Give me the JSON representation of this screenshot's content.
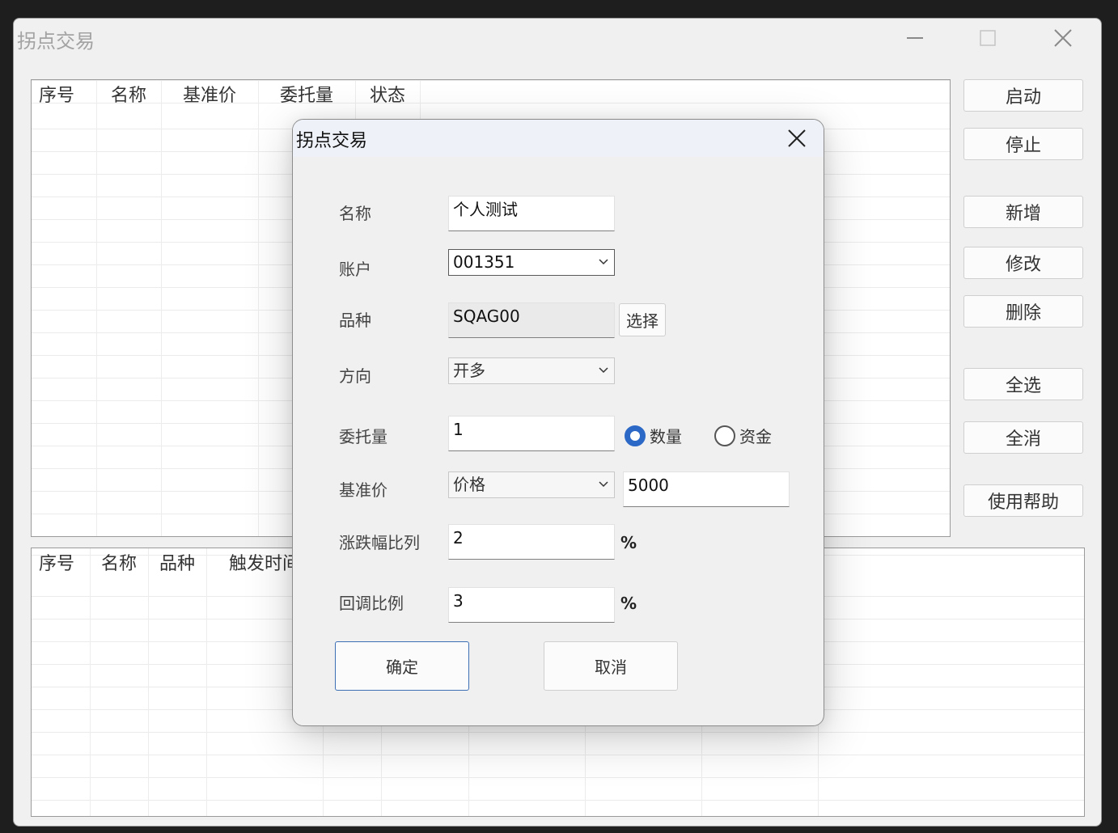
{
  "main_window": {
    "title": "拐点交易"
  },
  "top_table": {
    "columns": [
      "序号",
      "名称",
      "基准价",
      "委托量",
      "状态"
    ]
  },
  "bottom_table": {
    "columns": [
      "序号",
      "名称",
      "品种",
      "触发时间"
    ]
  },
  "side_buttons": {
    "start": "启动",
    "stop": "停止",
    "add": "新增",
    "edit": "修改",
    "delete": "删除",
    "select_all": "全选",
    "deselect_all": "全消",
    "help": "使用帮助"
  },
  "dialog": {
    "title": "拐点交易",
    "fields": {
      "name_label": "名称",
      "name_value": "个人测试",
      "account_label": "账户",
      "account_value": "001351",
      "symbol_label": "品种",
      "symbol_value": "SQAG00",
      "choose_button": "选择",
      "direction_label": "方向",
      "direction_value": "开多",
      "quantity_label": "委托量",
      "quantity_value": "1",
      "radio_quantity": "数量",
      "radio_funds": "资金",
      "radio_selected": "数量",
      "baseprice_label": "基准价",
      "baseprice_type": "价格",
      "baseprice_value": "5000",
      "change_ratio_label": "涨跌幅比列",
      "change_ratio_value": "2",
      "retrace_label": "回调比例",
      "retrace_value": "3",
      "percent_unit": "%"
    },
    "ok_button": "确定",
    "cancel_button": "取消"
  },
  "icons": {
    "minimize": "minimize-icon",
    "maximize": "maximize-icon",
    "close": "close-icon",
    "dropdown": "chevron-down-icon"
  },
  "colors": {
    "accent": "#2c69c7",
    "default_button_border": "#3d6fb5",
    "background": "#f0f0f0"
  }
}
